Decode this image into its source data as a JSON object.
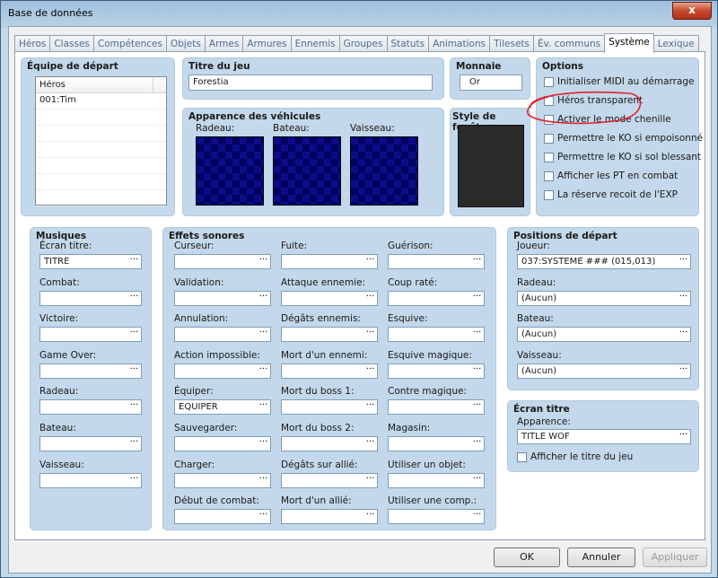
{
  "window": {
    "title": "Base de données",
    "close": "x"
  },
  "tabs": [
    "Héros",
    "Classes",
    "Compétences",
    "Objets",
    "Armes",
    "Armures",
    "Ennemis",
    "Groupes",
    "Statuts",
    "Animations",
    "Tilesets",
    "Év. communs",
    "Système",
    "Lexique"
  ],
  "active_tab": "Système",
  "start_team": {
    "title": "Équipe de départ",
    "header": "Héros",
    "items": [
      "001:Tim"
    ]
  },
  "game_title": {
    "title": "Titre du jeu",
    "value": "Forestia"
  },
  "currency": {
    "title": "Monnaie",
    "value": "Or"
  },
  "options": {
    "title": "Options",
    "items": [
      "Initialiser MIDI au démarrage",
      "Héros transparent",
      "Activer le mode chenille",
      "Permettre le KO si empoisonné",
      "Permettre le KO si sol blessant",
      "Afficher les PT en combat",
      "La réserve recoit de l'EXP"
    ]
  },
  "vehicles": {
    "title": "Apparence des véhicules",
    "labels": [
      "Radeau:",
      "Bateau:",
      "Vaisseau:"
    ]
  },
  "window_style": {
    "title": "Style de fenêtres"
  },
  "music": {
    "title": "Musiques",
    "fields": [
      {
        "label": "Écran titre:",
        "value": "TITRE"
      },
      {
        "label": "Combat:",
        "value": ""
      },
      {
        "label": "Victoire:",
        "value": ""
      },
      {
        "label": "Game Over:",
        "value": ""
      },
      {
        "label": "Radeau:",
        "value": ""
      },
      {
        "label": "Bateau:",
        "value": ""
      },
      {
        "label": "Vaisseau:",
        "value": ""
      }
    ]
  },
  "sounds": {
    "title": "Effets sonores",
    "col1": [
      {
        "label": "Curseur:",
        "value": ""
      },
      {
        "label": "Validation:",
        "value": ""
      },
      {
        "label": "Annulation:",
        "value": ""
      },
      {
        "label": "Action impossible:",
        "value": ""
      },
      {
        "label": "Équiper:",
        "value": "EQUIPER"
      },
      {
        "label": "Sauvegarder:",
        "value": ""
      },
      {
        "label": "Charger:",
        "value": ""
      },
      {
        "label": "Début de combat:",
        "value": ""
      }
    ],
    "col2": [
      {
        "label": "Fuite:",
        "value": ""
      },
      {
        "label": "Attaque ennemie:",
        "value": ""
      },
      {
        "label": "Dégâts ennemis:",
        "value": ""
      },
      {
        "label": "Mort d'un ennemi:",
        "value": ""
      },
      {
        "label": "Mort du boss 1:",
        "value": ""
      },
      {
        "label": "Mort du boss 2:",
        "value": ""
      },
      {
        "label": "Dégâts sur allié:",
        "value": ""
      },
      {
        "label": "Mort d'un allié:",
        "value": ""
      }
    ],
    "col3": [
      {
        "label": "Guérison:",
        "value": ""
      },
      {
        "label": "Coup raté:",
        "value": ""
      },
      {
        "label": "Esquive:",
        "value": ""
      },
      {
        "label": "Esquive magique:",
        "value": ""
      },
      {
        "label": "Contre magique:",
        "value": ""
      },
      {
        "label": "Magasin:",
        "value": ""
      },
      {
        "label": "Utiliser un objet:",
        "value": ""
      },
      {
        "label": "Utiliser une comp.:",
        "value": ""
      }
    ]
  },
  "start_positions": {
    "title": "Positions de départ",
    "fields": [
      {
        "label": "Joueur:",
        "value": "037:SYSTEME ### (015,013)"
      },
      {
        "label": "Radeau:",
        "value": "(Aucun)"
      },
      {
        "label": "Bateau:",
        "value": "(Aucun)"
      },
      {
        "label": "Vaisseau:",
        "value": "(Aucun)"
      }
    ]
  },
  "title_screen": {
    "title": "Écran titre",
    "label": "Apparence:",
    "value": "TITLE WOF",
    "checkbox": "Afficher le titre du jeu"
  },
  "buttons": {
    "ok": "OK",
    "cancel": "Annuler",
    "apply": "Appliquer"
  },
  "dots": "···",
  "colors": {
    "annotation": "#e0202a",
    "group_bg": "#c3d8ea"
  }
}
